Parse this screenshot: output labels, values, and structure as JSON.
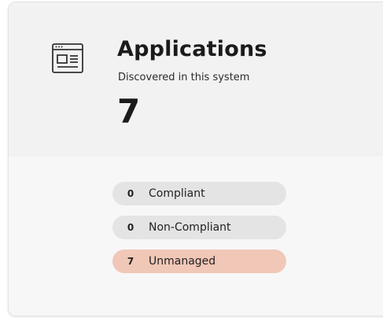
{
  "card": {
    "title": "Applications",
    "subtitle": "Discovered in this system",
    "count": "7",
    "icon": "application-window-icon"
  },
  "statuses": [
    {
      "count": "0",
      "label": "Compliant",
      "color": "#e4e4e4"
    },
    {
      "count": "0",
      "label": "Non-Compliant",
      "color": "#e4e4e4"
    },
    {
      "count": "7",
      "label": "Unmanaged",
      "color": "#f1c7b7"
    }
  ]
}
